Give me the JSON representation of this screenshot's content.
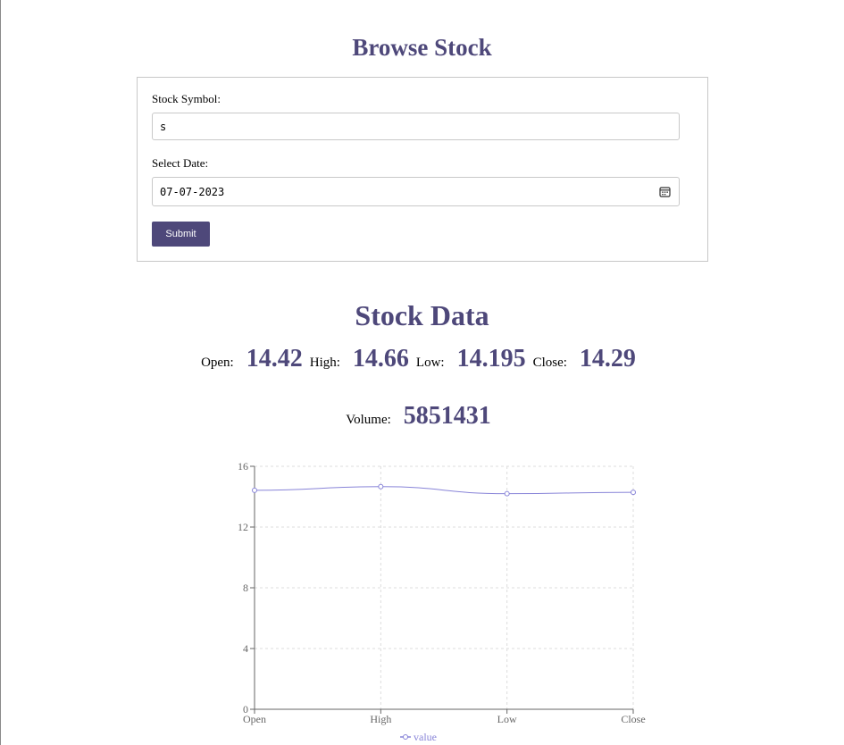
{
  "browse": {
    "title": "Browse Stock",
    "symbol_label": "Stock Symbol:",
    "symbol_value": "s",
    "date_label": "Select Date:",
    "date_value": "07-07-2023",
    "submit_label": "Submit"
  },
  "stock": {
    "title": "Stock Data",
    "open_label": "Open:",
    "open_value": "14.42",
    "high_label": "High:",
    "high_value": "14.66",
    "low_label": "Low:",
    "low_value": "14.195",
    "close_label": "Close:",
    "close_value": "14.29",
    "volume_label": "Volume:",
    "volume_value": "5851431"
  },
  "colors": {
    "accent": "#4e487a",
    "line": "#8884d8"
  },
  "chart_data": {
    "type": "line",
    "categories": [
      "Open",
      "High",
      "Low",
      "Close"
    ],
    "series": [
      {
        "name": "value",
        "values": [
          14.42,
          14.66,
          14.195,
          14.29
        ]
      }
    ],
    "yticks": [
      0,
      4,
      8,
      12,
      16
    ],
    "ylim": [
      0,
      16
    ],
    "grid": true,
    "legend": "bottom"
  }
}
